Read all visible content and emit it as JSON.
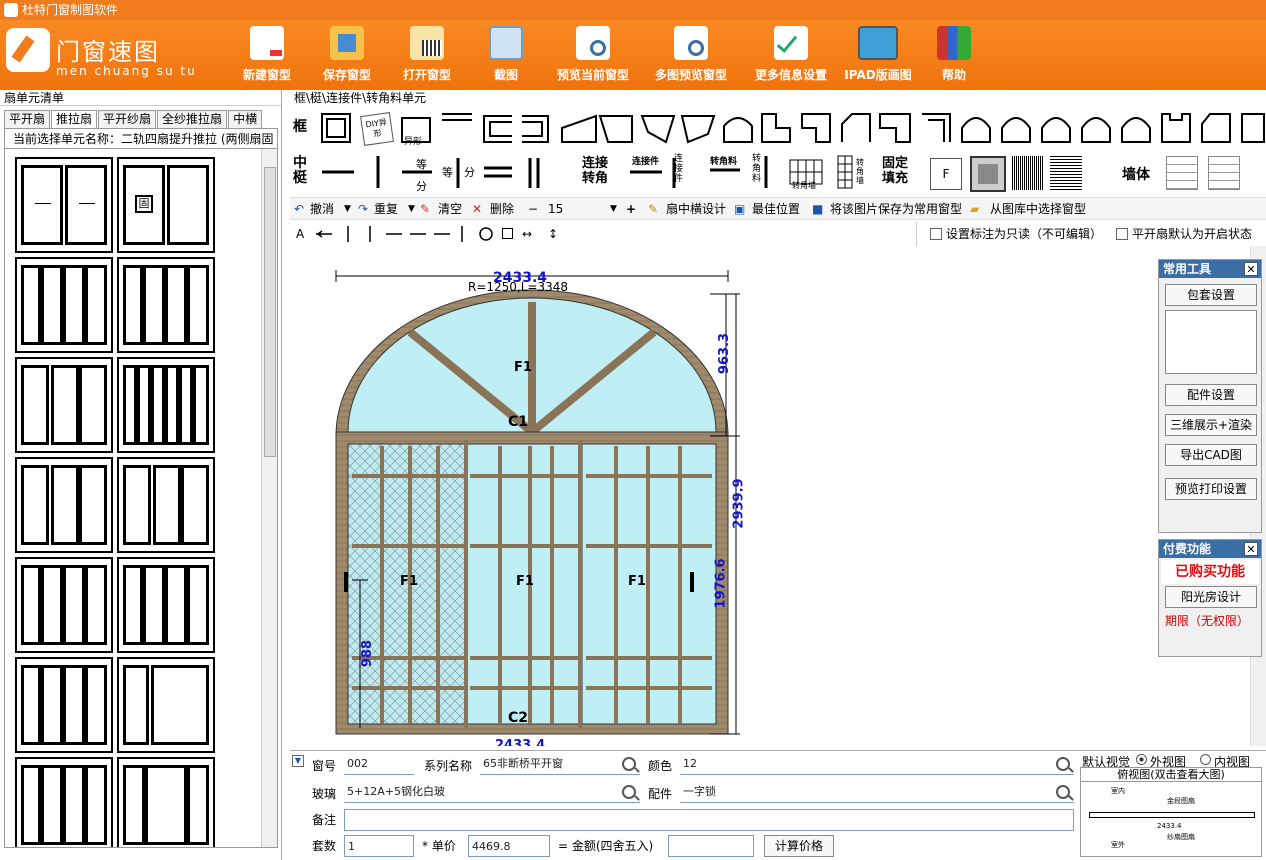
{
  "title": "杜特门窗制图软件",
  "logo": {
    "text": "门窗速图",
    "sub": "men chuang su tu"
  },
  "toolbar": [
    {
      "label": "新建窗型",
      "icon": "new-doc-icon"
    },
    {
      "label": "保存窗型",
      "icon": "save-icon"
    },
    {
      "label": "打开窗型",
      "icon": "open-folder-icon"
    },
    {
      "label": "截图",
      "icon": "screenshot-icon"
    },
    {
      "label": "预览当前窗型",
      "icon": "preview-icon"
    },
    {
      "label": "多图预览窗型",
      "icon": "multi-preview-icon"
    },
    {
      "label": "更多信息设置",
      "icon": "settings-check-icon"
    },
    {
      "label": "IPAD版画图",
      "icon": "ipad-icon"
    },
    {
      "label": "帮助",
      "icon": "help-books-icon"
    }
  ],
  "left": {
    "title": "扇单元清单",
    "tabs": [
      "平开扇",
      "推拉扇",
      "平开纱扇",
      "全纱推拉扇",
      "中横"
    ],
    "current": "当前选择单元名称：二轨四扇提升推拉 (两侧扇固"
  },
  "breadcrumb": "框\\梃\\连接件\\转角料单元",
  "rows": {
    "frame_label": "框",
    "mullion_label": "中梃",
    "equal_a": "等",
    "equal_b": "分",
    "equal_c": "等",
    "equal_d": "分",
    "connect1": "连接",
    "connect2": "转角",
    "connector": "连接件",
    "conn_v": "连接件",
    "corner_mat": "转角料",
    "corner_v": "转角料",
    "corner_wall": "转角墙",
    "corner_wall2": "转角墙",
    "fixed1": "固定",
    "fixed2": "填充",
    "f_letter": "F",
    "wall": "墙体",
    "diy": "DIY异形",
    "special": "异形"
  },
  "edit": {
    "undo": "撤消",
    "redo": "重复",
    "clear": "清空",
    "delete": "删除",
    "minus": "−",
    "size": "15",
    "plus": "+",
    "sash_mullion": "扇中横设计",
    "best_pos": "最佳位置",
    "save_common": "将该图片保存为常用窗型",
    "from_lib": "从图库中选择窗型"
  },
  "draw": {
    "readonly": "设置标注为只读（不可编辑）",
    "open_default": "平开扇默认为开启状态",
    "text_tool": "A"
  },
  "canvas": {
    "top_width": "2433.4",
    "radius": "R=1250,L=3348",
    "arc_h": "963.3",
    "total_h": "2939.9",
    "low_h": "1976.6",
    "sash_h": "988",
    "bottom_width": "2433.4",
    "f1": "F1",
    "c1": "C1",
    "c2": "C2",
    "ef1": "F1"
  },
  "tools": {
    "title": "常用工具",
    "close": "✕",
    "pack": "包套设置",
    "parts": "配件设置",
    "view3d": "三维展示+渲染",
    "cad": "导出CAD图",
    "print": "预览打印设置"
  },
  "paid": {
    "title": "付费功能",
    "close": "✕",
    "bought": "已购买功能",
    "sunroom": "阳光房设计",
    "term": "期限（无权限）"
  },
  "form": {
    "window_no_label": "窗号",
    "window_no": "002",
    "series_label": "系列名称",
    "series": "65非断桥平开窗",
    "color_label": "颜色",
    "color": "12",
    "glass_label": "玻璃",
    "glass": "5+12A+5钢化白玻",
    "fitting_label": "配件",
    "fitting": "一字锁",
    "note_label": "备注",
    "note": "",
    "sets_label": "套数",
    "sets": "1",
    "price_label": "* 单价",
    "price": "4469.8",
    "amount_label": "= 金额(四舍五入)",
    "amount": "",
    "calc": "计算价格",
    "view_label": "默认视觉",
    "outer": "外视图",
    "inner": "内视图",
    "plan": "俯视图(双击查看大图)",
    "plan_in": "室内",
    "plan_out": "室外",
    "plan_dim": "2433.4",
    "plan_top": "金段图扇",
    "plan_bot": "纱扇图扇"
  }
}
